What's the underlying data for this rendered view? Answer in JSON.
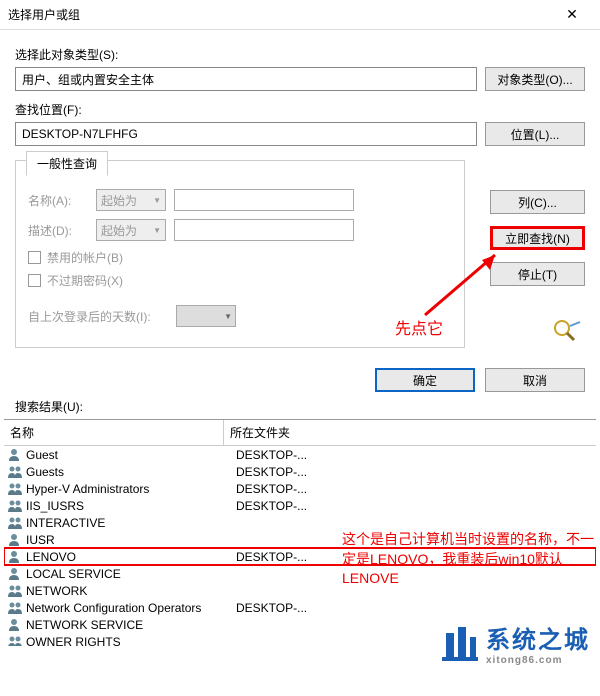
{
  "titlebar": {
    "title": "选择用户或组",
    "close": "✕"
  },
  "labels": {
    "objectType": "选择此对象类型(S):",
    "location": "查找位置(F):",
    "queryTab": "一般性查询",
    "name": "名称(A):",
    "desc": "描述(D):",
    "disabled": "禁用的帐户(B)",
    "noexpire": "不过期密码(X)",
    "days": "自上次登录后的天数(I):",
    "searchResult": "搜索结果(U):",
    "colName": "名称",
    "colFolder": "所在文件夹"
  },
  "values": {
    "objectType": "用户、组或内置安全主体",
    "location": "DESKTOP-N7LFHFG",
    "combo": "起始为"
  },
  "buttons": {
    "objectTypes": "对象类型(O)...",
    "locations": "位置(L)...",
    "columns": "列(C)...",
    "findNow": "立即查找(N)",
    "stop": "停止(T)",
    "ok": "确定",
    "cancel": "取消"
  },
  "annotations": {
    "clickFirst": "先点它",
    "lenovo": "这个是自己计算机当时设置的名称，不一定是LENOVO，我重装后win10默认LENOVE"
  },
  "watermark": {
    "main": "系统之城",
    "sub": "xitong86.com"
  },
  "results": [
    {
      "name": "Guest",
      "folder": "DESKTOP-...",
      "icon": "user"
    },
    {
      "name": "Guests",
      "folder": "DESKTOP-...",
      "icon": "group"
    },
    {
      "name": "Hyper-V Administrators",
      "folder": "DESKTOP-...",
      "icon": "group"
    },
    {
      "name": "IIS_IUSRS",
      "folder": "DESKTOP-...",
      "icon": "group"
    },
    {
      "name": "INTERACTIVE",
      "folder": "",
      "icon": "group"
    },
    {
      "name": "IUSR",
      "folder": "",
      "icon": "user"
    },
    {
      "name": "LENOVO",
      "folder": "DESKTOP-...",
      "icon": "user",
      "hl": true
    },
    {
      "name": "LOCAL SERVICE",
      "folder": "",
      "icon": "user"
    },
    {
      "name": "NETWORK",
      "folder": "",
      "icon": "group"
    },
    {
      "name": "Network Configuration Operators",
      "folder": "DESKTOP-...",
      "icon": "group"
    },
    {
      "name": "NETWORK SERVICE",
      "folder": "",
      "icon": "user"
    },
    {
      "name": "OWNER RIGHTS",
      "folder": "",
      "icon": "group"
    }
  ]
}
